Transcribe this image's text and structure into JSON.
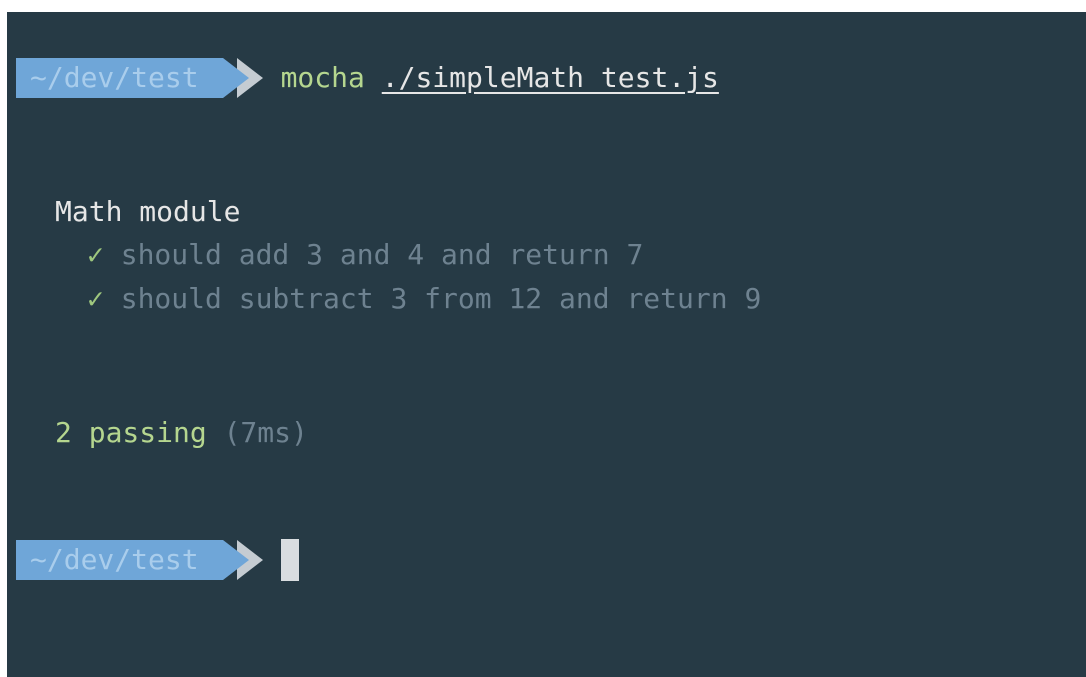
{
  "prompt": {
    "path": "~/dev/test"
  },
  "command": {
    "name": "mocha",
    "argument": "./simpleMath_test.js"
  },
  "output": {
    "suite_title": "Math module",
    "tests": [
      {
        "check": "✓",
        "title": "should add 3 and 4 and return 7"
      },
      {
        "check": "✓",
        "title": "should subtract 3 from 12 and return 9"
      }
    ],
    "summary": {
      "passing": "2 passing",
      "duration": "(7ms)"
    }
  },
  "colors": {
    "background": "#263a45",
    "prompt_segment": "#6fa6d8",
    "prompt_separator": "#c5ccd2",
    "success_green": "#b5d68f",
    "muted_text": "#6e8290"
  }
}
